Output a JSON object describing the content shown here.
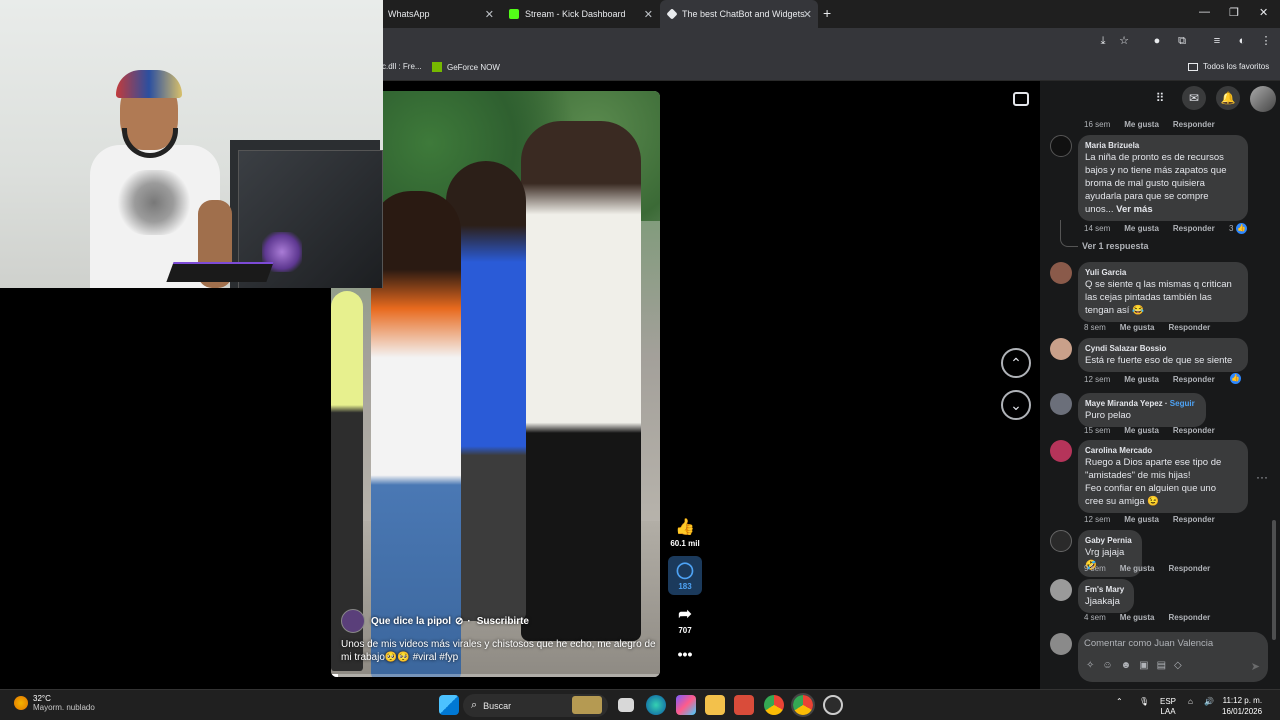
{
  "browser": {
    "tabs": [
      {
        "label": "WhatsApp"
      },
      {
        "label": "Stream - Kick Dashboard"
      },
      {
        "label": "The best ChatBot and Widgets"
      }
    ],
    "bookmarks": [
      {
        "label": "c.dll : Fre..."
      },
      {
        "label": "GeForce NOW"
      }
    ],
    "all_favorites": "Todos los favoritos"
  },
  "video": {
    "channel": "Que dice la pipol",
    "subscribe": "Suscribirte",
    "caption": "Unos de mis videos más virales y chistosos que he echo, me alegro de mi trabajo🥺🥺  #viral  #fyp",
    "progress": 0.02
  },
  "actions": {
    "likes": "60.1 mil",
    "comments": "183",
    "shares": "707"
  },
  "comments": [
    {
      "meta_time": "16 sem",
      "like": "Me gusta",
      "reply": "Responder"
    },
    {
      "name": "Maria Brizuela",
      "lines": [
        "La niña de pronto es de recursos",
        "bajos y no tiene más zapatos que",
        "broma de mal gusto quisiera",
        "ayudarla para que se compre",
        "unos..."
      ],
      "more": "Ver más",
      "time": "14 sem",
      "like": "Me gusta",
      "reply": "Responder",
      "reactions": "3",
      "replies": "Ver 1 respuesta"
    },
    {
      "name": "Yuli Garcia",
      "lines": [
        "Q se siente q las mismas q critican",
        "las cejas pintadas también las",
        "tengan así 😂"
      ],
      "time": "8 sem",
      "like": "Me gusta",
      "reply": "Responder"
    },
    {
      "name": "Cyndi Salazar Bossio",
      "lines": [
        "Está re fuerte eso de que se siente"
      ],
      "time": "12 sem",
      "like": "Me gusta",
      "reply": "Responder"
    },
    {
      "name": "Maye Miranda Yepez",
      "follow": "Seguir",
      "lines": [
        "Puro pelao"
      ],
      "time": "15 sem",
      "like": "Me gusta",
      "reply": "Responder"
    },
    {
      "name": "Carolina Mercado",
      "lines": [
        "Ruego a Dios aparte ese tipo de",
        "\"amistades\" de mis hijas!",
        "Feo confiar en alguien que uno",
        "cree su amiga 😉"
      ],
      "time": "12 sem",
      "like": "Me gusta",
      "reply": "Responder"
    },
    {
      "name": "Gaby Pernia",
      "lines": [
        "Vrg jajaja 🤣"
      ],
      "time": "9 sem",
      "like": "Me gusta",
      "reply": "Responder"
    },
    {
      "name": "Fm's Mary",
      "lines": [
        "Jjaakaja"
      ],
      "time": "4 sem",
      "like": "Me gusta",
      "reply": "Responder"
    }
  ],
  "composer": {
    "placeholder": "Comentar como Juan Valencia"
  },
  "taskbar": {
    "temp": "32°C",
    "weather": "Mayorm. nublado",
    "search": "Buscar",
    "lang1": "ESP",
    "lang2": "LAA",
    "time": "11:12 p. m.",
    "date": "16/01/2026"
  }
}
